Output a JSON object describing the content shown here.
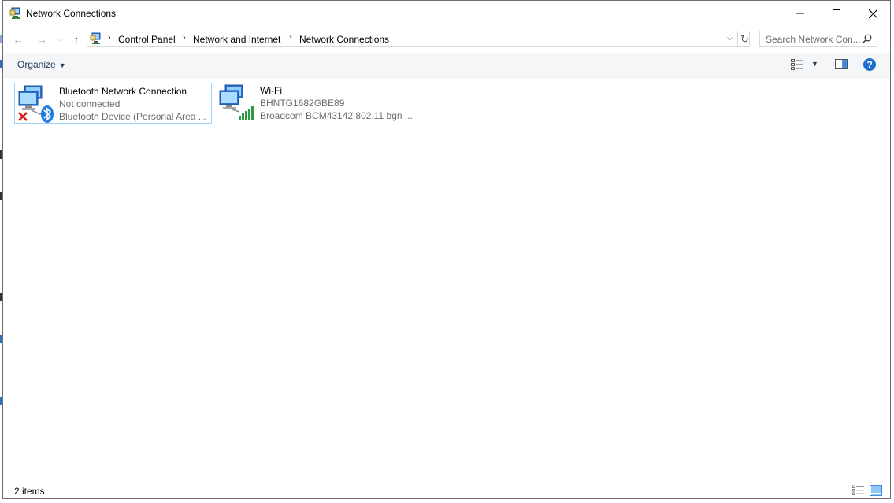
{
  "window": {
    "title": "Network Connections"
  },
  "nav": {
    "breadcrumb": [
      "Control Panel",
      "Network and Internet",
      "Network Connections"
    ],
    "search_placeholder": "Search Network Con..."
  },
  "toolbar": {
    "organize_label": "Organize"
  },
  "items": [
    {
      "name": "Bluetooth Network Connection",
      "status": "Not connected",
      "device": "Bluetooth Device (Personal Area ...",
      "icon": "bluetooth-network-icon",
      "selected": true
    },
    {
      "name": "Wi-Fi",
      "status": "BHNTG1682GBE89",
      "device": "Broadcom BCM43142 802.11 bgn ...",
      "icon": "wifi-network-icon",
      "selected": false
    }
  ],
  "statusbar": {
    "item_count": "2 items"
  },
  "colors": {
    "selection_border": "#99d1ff",
    "help_blue": "#1e6fd0",
    "secondary_text": "#6d6d6d"
  }
}
